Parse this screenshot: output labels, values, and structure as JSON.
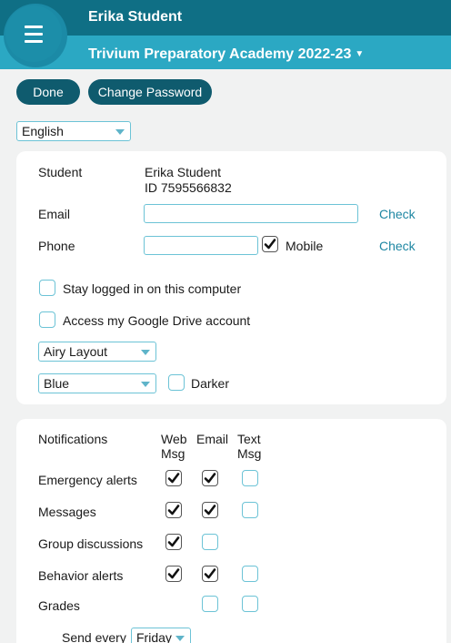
{
  "header": {
    "user_name": "Erika Student",
    "school": "Trivium Preparatory Academy  2022-23",
    "caret": "▼"
  },
  "toolbar": {
    "done_label": "Done",
    "change_password_label": "Change Password"
  },
  "language": {
    "selected": "English"
  },
  "profile": {
    "student_label": "Student",
    "student_name": "Erika Student",
    "student_id": "ID 7595566832",
    "email_label": "Email",
    "email_value": "",
    "email_check": "Check",
    "phone_label": "Phone",
    "phone_value": "",
    "mobile_label": "Mobile",
    "mobile_checked": true,
    "phone_check": "Check",
    "stay_logged_in_label": "Stay logged in on this computer",
    "stay_logged_in_checked": false,
    "google_drive_label": "Access my Google Drive account",
    "google_drive_checked": false,
    "layout_selected": "Airy Layout",
    "theme_selected": "Blue",
    "darker_label": "Darker",
    "darker_checked": false
  },
  "notifications": {
    "title": "Notifications",
    "col_web_line1": "Web",
    "col_web_line2": "Msg",
    "col_email": "Email",
    "col_text_line1": "Text",
    "col_text_line2": "Msg",
    "rows": [
      {
        "label": "Emergency alerts",
        "web": true,
        "email": true,
        "text": false
      },
      {
        "label": "Messages",
        "web": true,
        "email": true,
        "text": false
      },
      {
        "label": "Group discussions",
        "web": true,
        "email": false,
        "text": null
      },
      {
        "label": "Behavior alerts",
        "web": true,
        "email": true,
        "text": false
      },
      {
        "label": "Grades",
        "web": null,
        "email": false,
        "text": false
      }
    ],
    "send_every_label": "Send every",
    "send_every_selected": "Friday"
  },
  "colors": {
    "header_dark": "#0f6f85",
    "header_light": "#2ba8c3",
    "button": "#0f5b6e",
    "link": "#1f87a3",
    "border": "#6cc3d6"
  }
}
